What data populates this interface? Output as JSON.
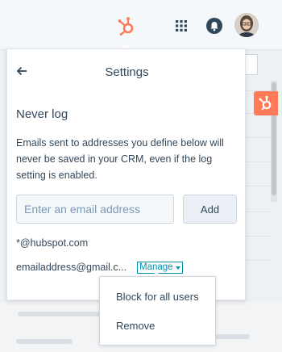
{
  "colors": {
    "accent": "#ff7a59",
    "link": "#0091ae",
    "text": "#33475b"
  },
  "header": {
    "logo_icon": "hubspot-sprocket-icon",
    "apps_icon": "grid-icon",
    "notifications_icon": "bell-icon",
    "avatar": "user-avatar"
  },
  "panel": {
    "title": "Settings",
    "back_icon": "arrow-left-icon",
    "section_title": "Never log",
    "description": "Emails sent to addresses you define below will never be saved in your CRM, even if the log setting is enabled.",
    "email_input": {
      "value": "",
      "placeholder": "Enter an email address"
    },
    "add_label": "Add",
    "entries": [
      {
        "text": "*@hubspot.com"
      },
      {
        "text": "emailaddress@gmail.c..."
      }
    ],
    "manage_label": "Manage"
  },
  "manage_menu": {
    "items": [
      {
        "label": "Block for all users"
      },
      {
        "label": "Remove"
      }
    ]
  }
}
